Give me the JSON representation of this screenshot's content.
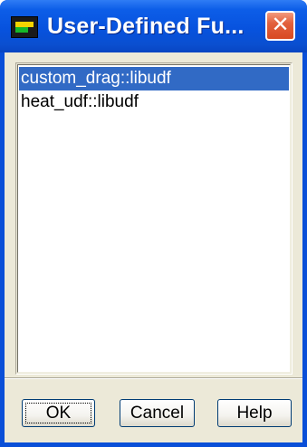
{
  "window": {
    "title": "User-Defined Fu...",
    "close_glyph": "✕"
  },
  "list": {
    "items": [
      {
        "label": "custom_drag::libudf",
        "selected": true
      },
      {
        "label": "heat_udf::libudf",
        "selected": false
      }
    ]
  },
  "buttons": {
    "ok_label": "OK",
    "cancel_label": "Cancel",
    "help_label": "Help"
  },
  "colors": {
    "titlebar": "#0752de",
    "selection": "#316ac5",
    "dialog_face": "#ece9d8",
    "close_button": "#e2613d"
  }
}
